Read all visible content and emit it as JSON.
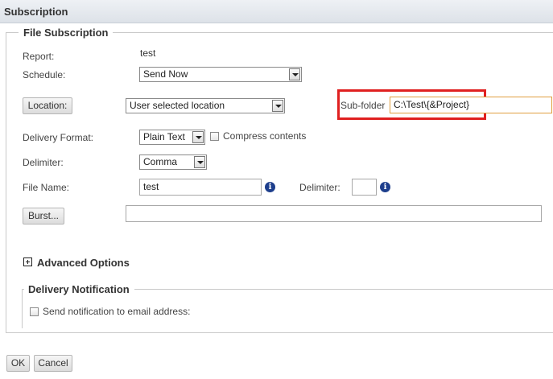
{
  "window": {
    "title": "Subscription"
  },
  "file_subscription": {
    "legend": "File Subscription",
    "report_label": "Report:",
    "report_value": "test",
    "schedule_label": "Schedule:",
    "schedule_value": "Send Now",
    "location_button": "Location:",
    "location_value": "User selected location",
    "subfolder_label": "Sub-folder",
    "subfolder_value": "C:\\Test\\{&Project}",
    "delivery_format_label": "Delivery Format:",
    "delivery_format_value": "Plain Text",
    "compress_label": "Compress contents",
    "compress_checked": false,
    "delimiter_label": "Delimiter:",
    "delimiter_value": "Comma",
    "file_name_label": "File Name:",
    "file_name_value": "test",
    "file_delimiter_label": "Delimiter:",
    "file_delimiter_value": "",
    "burst_button": "Burst...",
    "burst_value": "",
    "advanced_options": "Advanced Options",
    "highlight_color": "#e02020"
  },
  "delivery_notification": {
    "legend": "Delivery Notification",
    "send_email_label": "Send notification to email address:",
    "send_email_checked": false
  },
  "footer": {
    "ok_label": "OK",
    "cancel_label": "Cancel"
  }
}
